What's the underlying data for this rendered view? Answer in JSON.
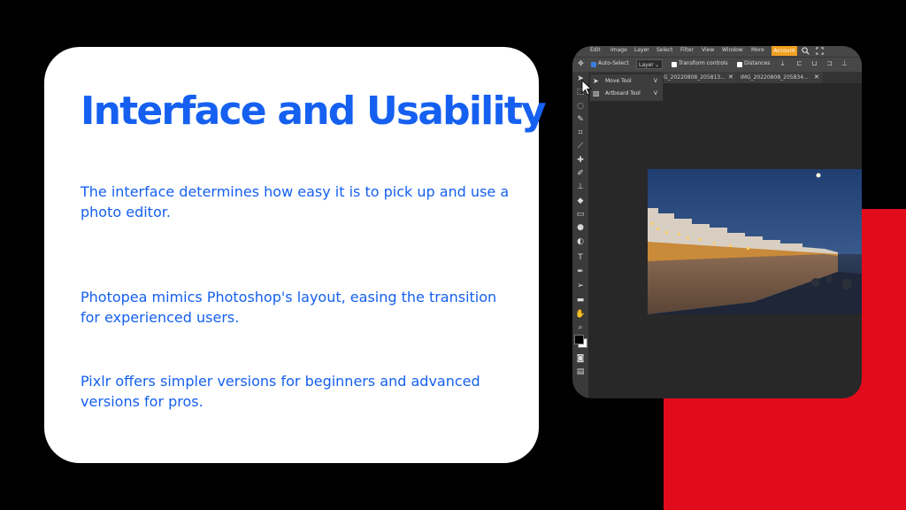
{
  "slide": {
    "title": "Interface and Usability",
    "paragraphs": [
      "The interface determines how easy it is to pick up and use a photo editor.",
      "Photopea mimics Photoshop's layout, easing the transition for experienced users.",
      "Pixlr offers simpler versions for beginners and advanced versions for pros."
    ]
  },
  "editor": {
    "menu": [
      "Edit",
      "Image",
      "Layer",
      "Select",
      "Filter",
      "View",
      "Window",
      "More"
    ],
    "account_label": "Account",
    "options": {
      "auto_select_label": "Auto-Select",
      "auto_select_checked": true,
      "select_value": "Layer",
      "transform_controls_label": "Transform controls",
      "distances_label": "Distances"
    },
    "tabs": [
      {
        "label": "G_20220808_205813...",
        "close": "✕"
      },
      {
        "label": "IMG_20220808_205834...",
        "close": "✕"
      }
    ],
    "flyout": [
      {
        "label": "Move Tool",
        "shortcut": "V"
      },
      {
        "label": "Artboard Tool",
        "shortcut": "V"
      }
    ],
    "tools": [
      "move-tool-icon",
      "marquee-tool-icon",
      "lasso-tool-icon",
      "magic-wand-icon",
      "crop-tool-icon",
      "eyedropper-icon",
      "healing-brush-icon",
      "brush-tool-icon",
      "clone-stamp-icon",
      "eraser-tool-icon",
      "gradient-tool-icon",
      "blur-tool-icon",
      "dodge-tool-icon",
      "pen-tool-icon",
      "type-tool-icon",
      "path-select-icon",
      "shape-tool-icon",
      "hand-tool-icon",
      "zoom-tool-icon"
    ],
    "colors": {
      "accent": "#1560f0",
      "account": "#f0a020",
      "red_block": "#e20b1b"
    }
  }
}
